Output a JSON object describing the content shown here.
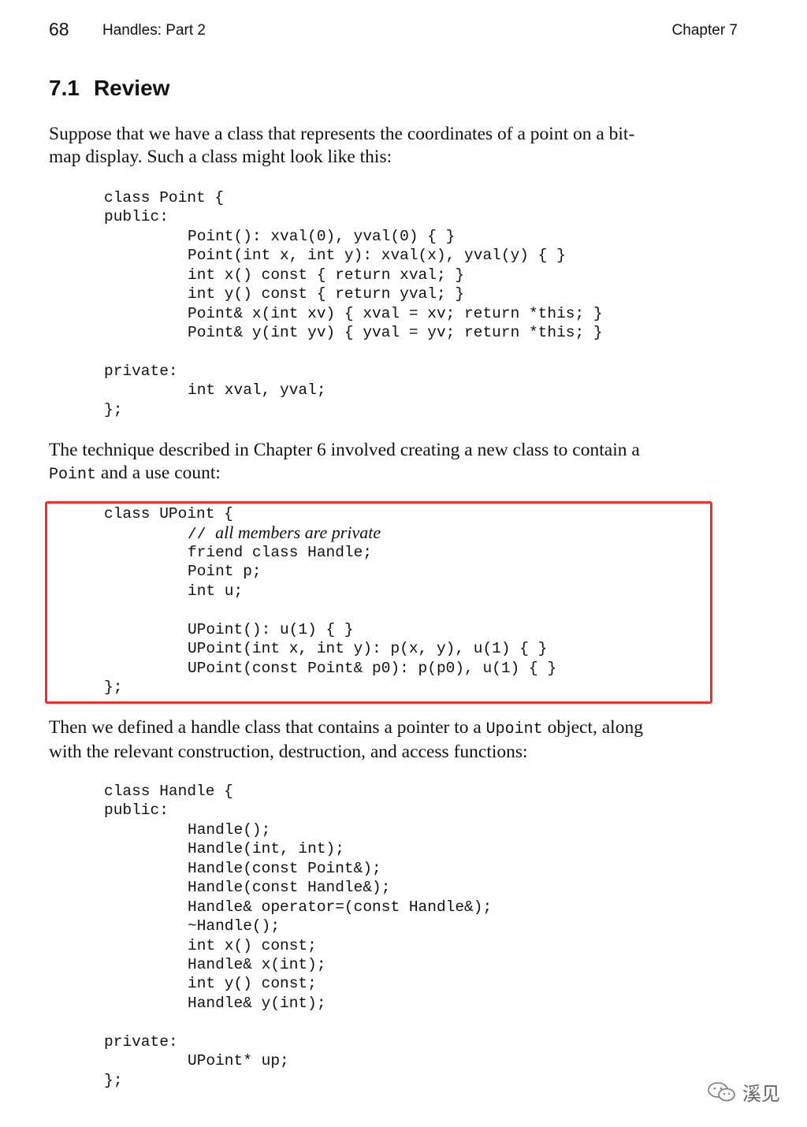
{
  "header": {
    "page_number": "68",
    "running_title": "Handles: Part 2",
    "chapter": "Chapter 7"
  },
  "section": {
    "number": "7.1",
    "title": "Review"
  },
  "paragraphs": {
    "p1": {
      "line1": "Suppose that we have a class that represents the coordinates of a point on a bit-",
      "line2": "map display. Such a class might look like this:"
    },
    "p2": {
      "line1": "The technique described in Chapter 6 involved creating a new class to contain a",
      "code_word": "Point",
      "line2_rest": " and a use count:"
    },
    "p3": {
      "line1_start": "Then we defined a handle class that contains a pointer to a ",
      "code_word": "Upoint",
      "line1_end": " object, along",
      "line2": "with the relevant construction, destruction, and access functions:"
    }
  },
  "code_blocks": {
    "point_class": [
      "class Point {",
      "public:",
      "Point(): xval(0), yval(0) { }",
      "Point(int x, int y): xval(x), yval(y) { }",
      "int x() const { return xval; }",
      "int y() const { return yval; }",
      "Point& x(int xv) { xval = xv; return *this; }",
      "Point& y(int yv) { yval = yv; return *this; }",
      "private:",
      "int xval, yval;",
      "};"
    ],
    "upoint_class": [
      "class UPoint {",
      "//",
      "all members are private",
      "friend class Handle;",
      "Point p;",
      "int u;",
      "UPoint(): u(1) { }",
      "UPoint(int x, int y): p(x, y), u(1) { }",
      "UPoint(const Point& p0): p(p0), u(1) { }",
      "};"
    ],
    "handle_class": [
      "class Handle {",
      "public:",
      "Handle();",
      "Handle(int, int);",
      "Handle(const Point&);",
      "Handle(const Handle&);",
      "Handle& operator=(const Handle&);",
      "~Handle();",
      "int x() const;",
      "Handle& x(int);",
      "int y() const;",
      "Handle& y(int);",
      "private:",
      "UPoint* up;",
      "};"
    ]
  },
  "watermark": {
    "icon": "wechat-icon",
    "text": "溪见"
  },
  "colors": {
    "highlight_border": "#e8332e",
    "text": "#111111"
  }
}
